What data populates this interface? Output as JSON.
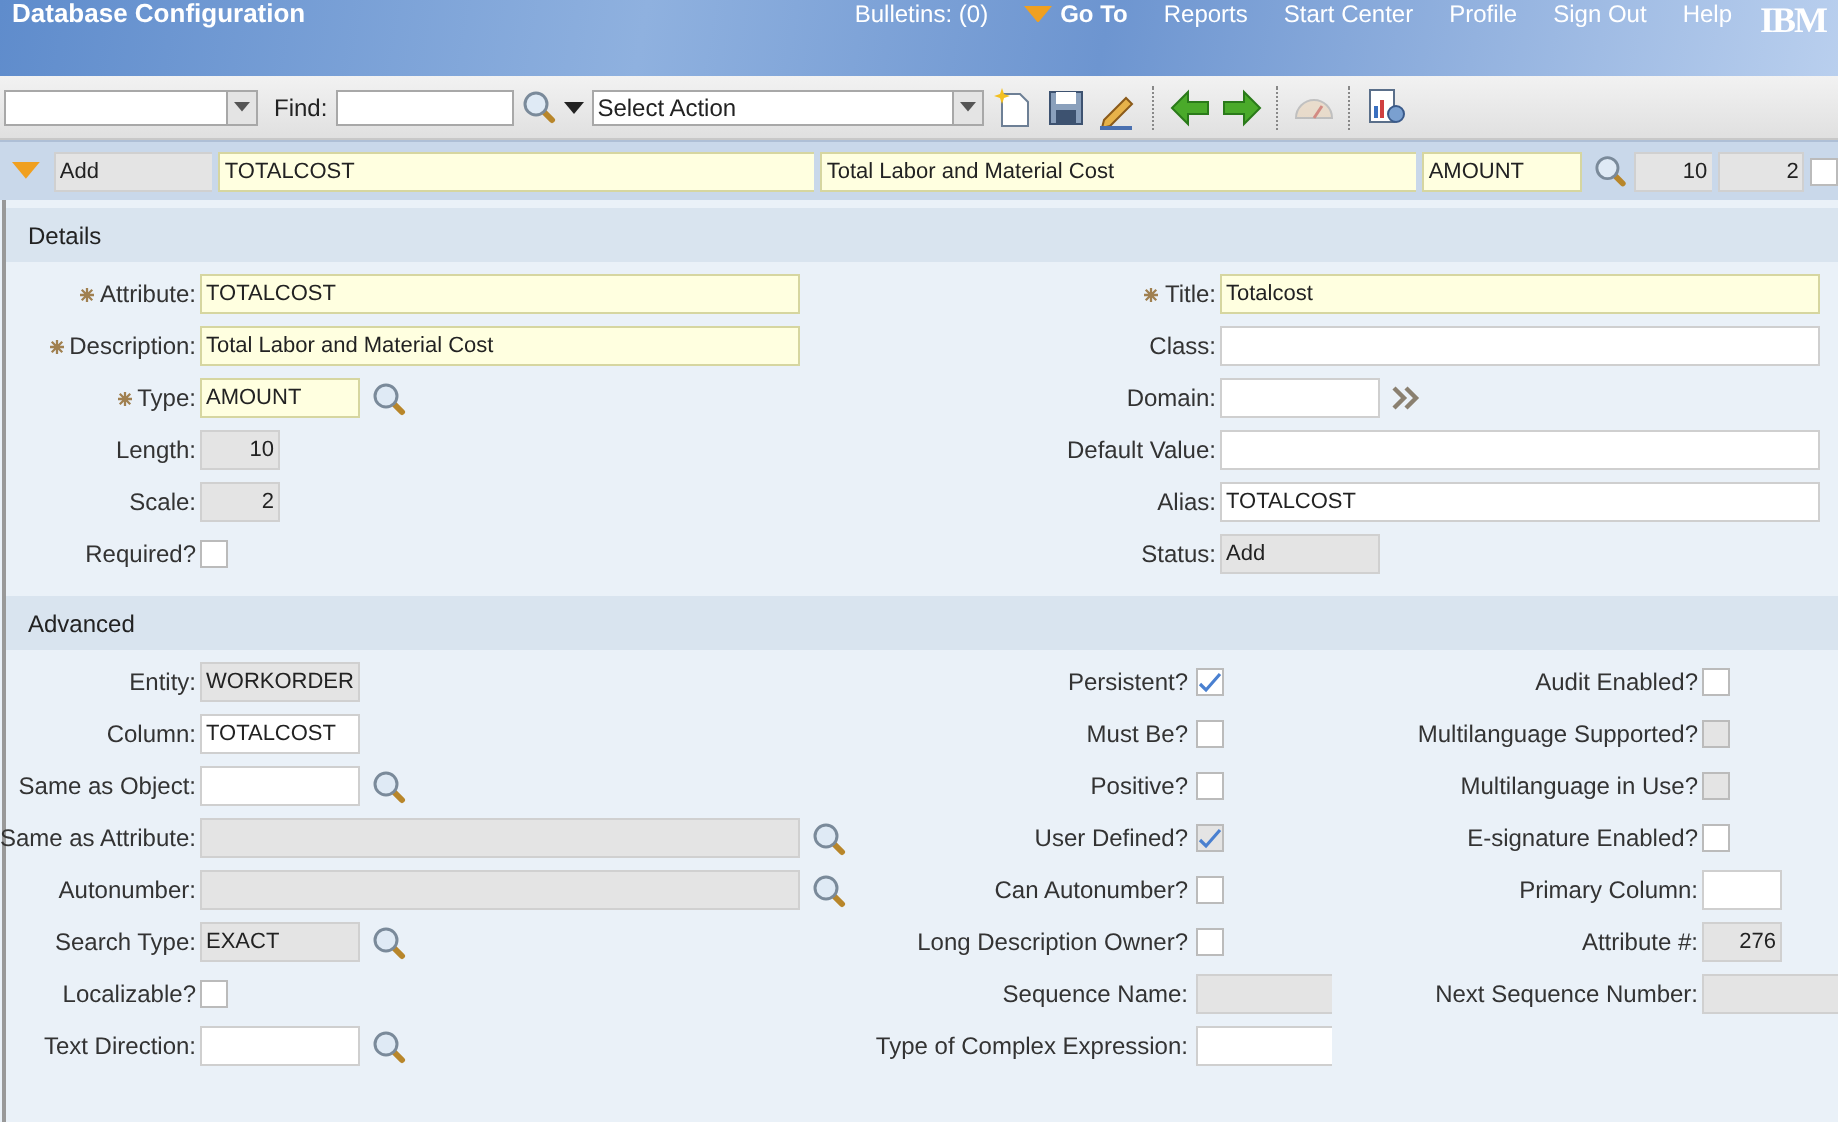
{
  "header": {
    "title": "Database Configuration",
    "nav": [
      {
        "kind": "link",
        "label": "Bulletins: (0)"
      },
      {
        "kind": "menu",
        "label": "Go To"
      },
      {
        "kind": "link",
        "label": "Reports"
      },
      {
        "kind": "link",
        "label": "Start Center"
      },
      {
        "kind": "link",
        "label": "Profile"
      },
      {
        "kind": "link",
        "label": "Sign Out"
      },
      {
        "kind": "link",
        "label": "Help"
      }
    ],
    "logo": "IBM"
  },
  "toolbar": {
    "find_label": "Find:",
    "action_select": "Select Action"
  },
  "record_bar": [
    {
      "kind": "readonly",
      "value": "Add"
    },
    {
      "kind": "required",
      "value": "TOTALCOST"
    },
    {
      "kind": "required",
      "value": "Total Labor and Material Cost"
    },
    {
      "kind": "required",
      "value": "AMOUNT"
    },
    {
      "kind": "readonly",
      "value": "10"
    },
    {
      "kind": "readonly",
      "value": "2"
    },
    {
      "kind": "checkbox",
      "checked": false,
      "disabled": false
    }
  ],
  "details": {
    "title": "Details",
    "rows": [
      [
        {
          "label": "Attribute:",
          "control": {
            "kind": "required",
            "value": "TOTALCOST"
          }
        },
        {
          "label": "Title:",
          "control": {
            "kind": "required",
            "value": "Totalcost"
          }
        }
      ],
      [
        {
          "label": "Description:",
          "control": {
            "kind": "required",
            "value": "Total Labor and Material Cost"
          }
        },
        {
          "label": "Class:",
          "control": {
            "kind": "text"
          }
        }
      ],
      [
        {
          "label": "Type:",
          "control": {
            "kind": "required",
            "value": "AMOUNT"
          }
        },
        {
          "label": "Domain:",
          "control": {
            "kind": "text"
          }
        }
      ],
      [
        {
          "label": "Length:",
          "control": {
            "kind": "readonly",
            "value": "10"
          }
        },
        {
          "label": "Default Value:",
          "control": {
            "kind": "text"
          }
        }
      ],
      [
        {
          "label": "Scale:",
          "control": {
            "kind": "readonly",
            "value": "2"
          }
        },
        {
          "label": "Alias:",
          "control": {
            "kind": "text",
            "value": "TOTALCOST"
          }
        }
      ],
      [
        {
          "label": "Required?",
          "control": {
            "kind": "checkbox",
            "checked": false,
            "disabled": false
          }
        },
        {
          "label": "Status:",
          "control": {
            "kind": "readonly",
            "value": "Add"
          }
        }
      ]
    ]
  },
  "advanced": {
    "title": "Advanced",
    "rows": [
      [
        {
          "label": "Entity:",
          "control": {
            "kind": "readonly",
            "value": "WORKORDER"
          }
        },
        {
          "label": "Persistent?",
          "control": {
            "kind": "checkbox",
            "checked": true,
            "disabled": false
          }
        },
        {
          "label": "Audit Enabled?",
          "control": {
            "kind": "checkbox",
            "checked": false,
            "disabled": false
          }
        }
      ],
      [
        {
          "label": "Column:",
          "control": {
            "kind": "text",
            "value": "TOTALCOST"
          }
        },
        {
          "label": "Must Be?",
          "control": {
            "kind": "checkbox",
            "checked": false,
            "disabled": false
          }
        },
        {
          "label": "Multilanguage Supported?",
          "control": {
            "kind": "checkbox",
            "checked": false,
            "disabled": true
          }
        }
      ],
      [
        {
          "label": "Same as Object:",
          "control": {
            "kind": "text"
          }
        },
        {
          "label": "Positive?",
          "control": {
            "kind": "checkbox",
            "checked": false,
            "disabled": false
          }
        },
        {
          "label": "Multilanguage in Use?",
          "control": {
            "kind": "checkbox",
            "checked": false,
            "disabled": true
          }
        }
      ],
      [
        {
          "label": "Same as Attribute:",
          "control": {
            "kind": "readonly"
          }
        },
        {
          "label": "User Defined?",
          "control": {
            "kind": "checkbox",
            "checked": true,
            "disabled": true
          }
        },
        {
          "label": "E-signature Enabled?",
          "control": {
            "kind": "checkbox",
            "checked": false,
            "disabled": false
          }
        }
      ],
      [
        {
          "label": "Autonumber:",
          "control": {
            "kind": "readonly"
          }
        },
        {
          "label": "Can Autonumber?",
          "control": {
            "kind": "checkbox",
            "checked": false,
            "disabled": false
          }
        },
        {
          "label": "Primary Column:",
          "control": {
            "kind": "text"
          }
        }
      ],
      [
        {
          "label": "Search Type:",
          "control": {
            "kind": "readonly",
            "value": "EXACT"
          }
        },
        {
          "label": "Long Description Owner?",
          "control": {
            "kind": "checkbox",
            "checked": false,
            "disabled": false
          }
        },
        {
          "label": "Attribute #:",
          "control": {
            "kind": "readonly",
            "value": "276"
          }
        }
      ],
      [
        {
          "label": "Localizable?",
          "control": {
            "kind": "checkbox",
            "checked": false,
            "disabled": false
          }
        },
        {
          "label": "Sequence Name:",
          "control": {
            "kind": "readonly"
          }
        },
        {
          "label": "Next Sequence Number:",
          "control": {
            "kind": "readonly"
          }
        }
      ],
      [
        {
          "label": "Text Direction:",
          "control": {
            "kind": "text"
          }
        },
        {
          "label": "Type of Complex Expression:",
          "control": {
            "kind": "text"
          }
        }
      ]
    ]
  }
}
